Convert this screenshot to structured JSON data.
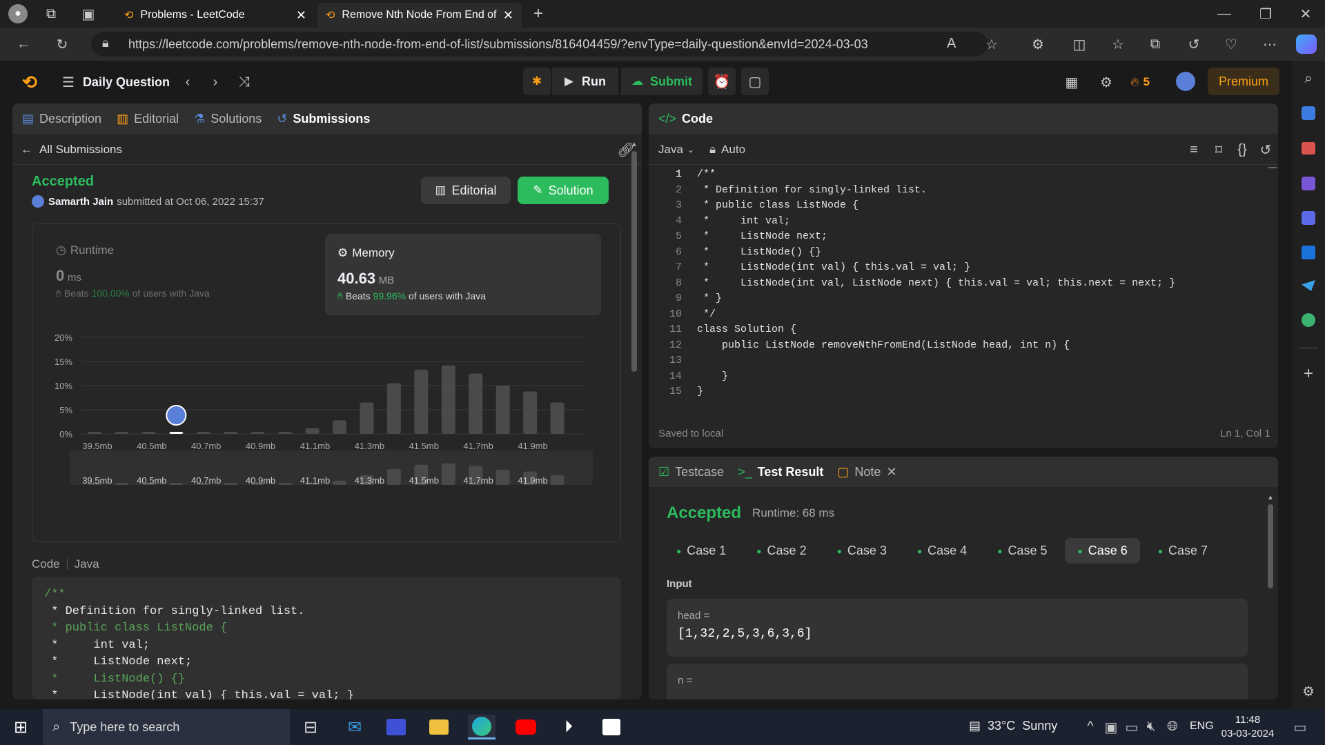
{
  "browser": {
    "tabs": [
      {
        "label": "Problems - LeetCode"
      },
      {
        "label": "Remove Nth Node From End of L"
      }
    ],
    "url": "https://leetcode.com/problems/remove-nth-node-from-end-of-list/submissions/816404459/?envType=daily-question&envId=2024-03-03"
  },
  "nav": {
    "title": "Daily Question",
    "run": "Run",
    "submit": "Submit",
    "streak": "5",
    "premium": "Premium"
  },
  "left": {
    "tabs": [
      "Description",
      "Editorial",
      "Solutions",
      "Submissions"
    ],
    "back": "All Submissions",
    "status": "Accepted",
    "user": "Samarth Jain",
    "submitted": "submitted at Oct 06, 2022 15:37",
    "editorial_btn": "Editorial",
    "solution_btn": "Solution",
    "runtime": {
      "label": "Runtime",
      "value": "0",
      "unit": "ms",
      "beats_prefix": "Beats",
      "beats": "100.00%",
      "beats_suffix": "of users with Java"
    },
    "memory": {
      "label": "Memory",
      "value": "40.63",
      "unit": "MB",
      "beats_prefix": "Beats",
      "beats": "99.96%",
      "beats_suffix": "of users with Java"
    },
    "code_label": "Code",
    "code_lang": "Java",
    "code_lines": [
      "/**",
      " * Definition for singly-linked list.",
      " * public class ListNode {",
      " *     int val;",
      " *     ListNode next;",
      " *     ListNode() {}",
      " *     ListNode(int val) { this.val = val; }"
    ]
  },
  "chart_data": {
    "type": "bar",
    "yticks": [
      "20%",
      "15%",
      "10%",
      "5%",
      "0%"
    ],
    "ylim": [
      0,
      20
    ],
    "xticks": [
      "39.5mb",
      "40.5mb",
      "40.7mb",
      "40.9mb",
      "41.1mb",
      "41.3mb",
      "41.5mb",
      "41.7mb",
      "41.9mb"
    ],
    "values": [
      0.3,
      0.3,
      0.3,
      0.3,
      0.3,
      0.3,
      0.3,
      0.3,
      1.2,
      2.8,
      6.5,
      10.5,
      13.3,
      14.2,
      12.5,
      10.0,
      8.8,
      6.5
    ],
    "highlight_index": 3,
    "mini_labels": [
      "39.5mb",
      "40.5mb",
      "40.7mb",
      "40.9mb",
      "41.1mb",
      "41.3mb",
      "41.5mb",
      "41.7mb",
      "41.9mb"
    ]
  },
  "code": {
    "title": "Code",
    "lang": "Java",
    "mode": "Auto",
    "lines": [
      "/**",
      " * Definition for singly-linked list.",
      " * public class ListNode {",
      " *     int val;",
      " *     ListNode next;",
      " *     ListNode() {}",
      " *     ListNode(int val) { this.val = val; }",
      " *     ListNode(int val, ListNode next) { this.val = val; this.next = next; }",
      " * }",
      " */",
      "class Solution {",
      "    public ListNode removeNthFromEnd(ListNode head, int n) {",
      "        ",
      "    }",
      "}"
    ],
    "numbers": [
      "1",
      "2",
      "3",
      "4",
      "5",
      "6",
      "7",
      "8",
      "9",
      "10",
      "11",
      "12",
      "13",
      "14",
      "15"
    ],
    "saved": "Saved to local",
    "position": "Ln 1, Col 1"
  },
  "result": {
    "tabs": [
      "Testcase",
      "Test Result",
      "Note"
    ],
    "status": "Accepted",
    "runtime": "Runtime: 68 ms",
    "cases": [
      "Case 1",
      "Case 2",
      "Case 3",
      "Case 4",
      "Case 5",
      "Case 6",
      "Case 7"
    ],
    "active_case": 5,
    "input_label": "Input",
    "head_label": "head =",
    "head_value": "[1,32,2,5,3,6,3,6]",
    "n_label": "n ="
  },
  "taskbar": {
    "search": "Type here to search",
    "weather": "33°C  Sunny",
    "lang": "ENG",
    "time": "11:48",
    "date": "03-03-2024"
  }
}
